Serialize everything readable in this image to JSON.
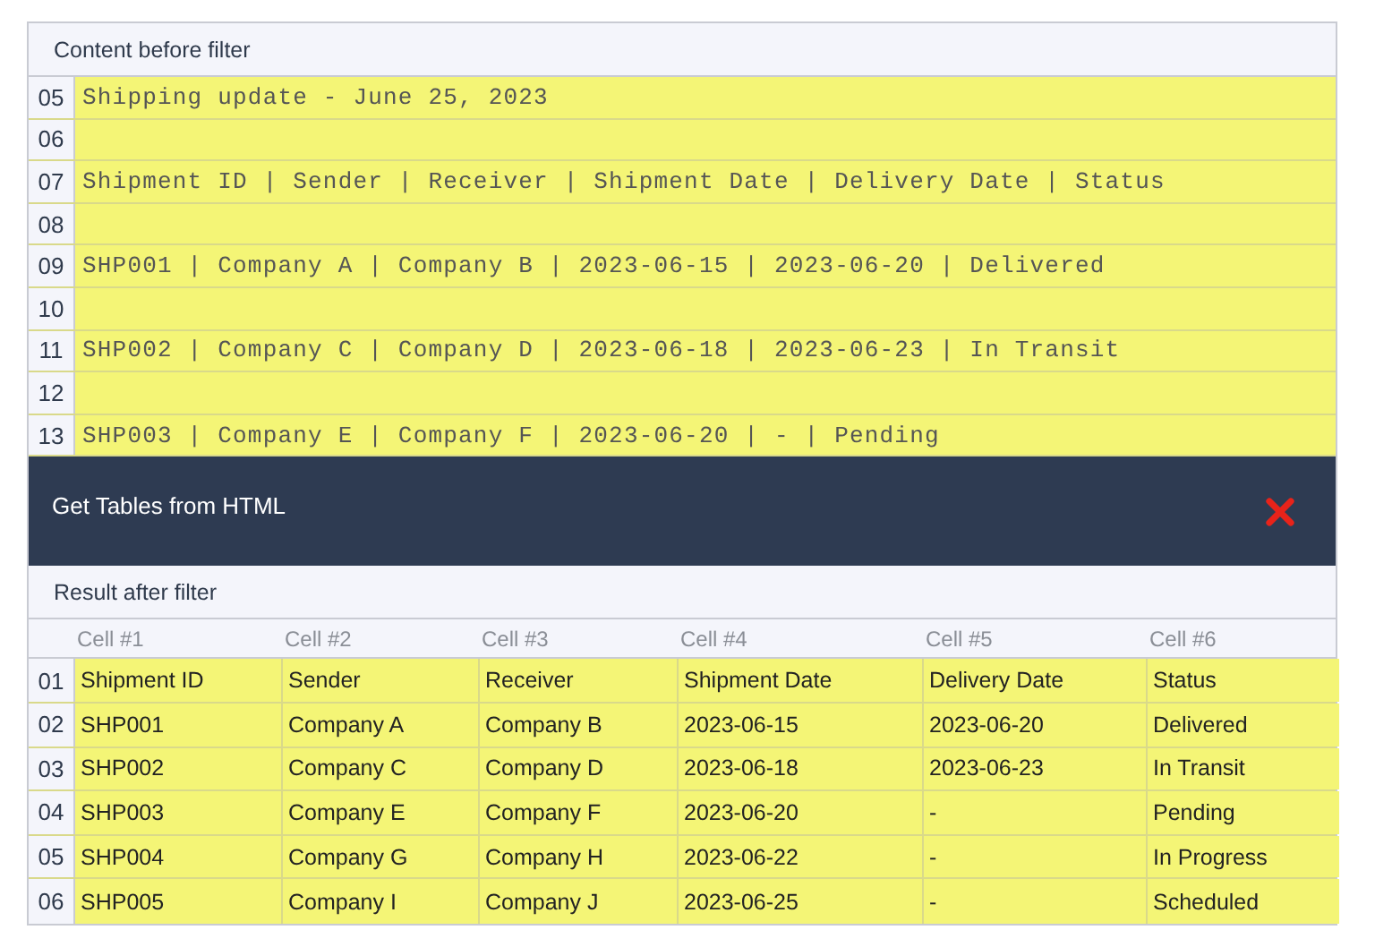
{
  "source_panel": {
    "title": "Content before filter",
    "lines": [
      {
        "number": "05",
        "text": "Shipping update - June 25, 2023"
      },
      {
        "number": "06"
      },
      {
        "number": "07",
        "text": "Shipment ID | Sender | Receiver | Shipment Date | Delivery Date | Status"
      },
      {
        "number": "08"
      },
      {
        "number": "09",
        "text": "SHP001 | Company A | Company B | 2023-06-15 | 2023-06-20 | Delivered"
      },
      {
        "number": "10"
      },
      {
        "number": "11",
        "text": "SHP002 | Company C | Company D | 2023-06-18 | 2023-06-23 | In Transit"
      },
      {
        "number": "12"
      },
      {
        "number": "13",
        "text": "SHP003 | Company E | Company F | 2023-06-20 | - | Pending"
      }
    ]
  },
  "toolbar": {
    "title": "Get Tables from HTML"
  },
  "result_panel": {
    "title": "Result after filter",
    "columns": [
      "Cell #1",
      "Cell #2",
      "Cell #3",
      "Cell #4",
      "Cell #5",
      "Cell #6"
    ],
    "rows": [
      {
        "number": "01",
        "cells": [
          "Shipment ID",
          "Sender",
          "Receiver",
          "Shipment Date",
          "Delivery Date",
          "Status"
        ]
      },
      {
        "number": "02",
        "cells": [
          "SHP001",
          "Company A",
          "Company B",
          "2023-06-15",
          "2023-06-20",
          "Delivered"
        ]
      },
      {
        "number": "03",
        "cells": [
          "SHP002",
          "Company C",
          "Company D",
          "2023-06-18",
          "2023-06-23",
          "In Transit"
        ]
      },
      {
        "number": "04",
        "cells": [
          "SHP003",
          "Company E",
          "Company F",
          "2023-06-20",
          "-",
          "Pending"
        ]
      },
      {
        "number": "05",
        "cells": [
          "SHP004",
          "Company G",
          "Company H",
          "2023-06-22",
          "-",
          "In Progress"
        ]
      },
      {
        "number": "06",
        "cells": [
          "SHP005",
          "Company I",
          "Company J",
          "2023-06-25",
          "-",
          "Scheduled"
        ]
      }
    ]
  }
}
